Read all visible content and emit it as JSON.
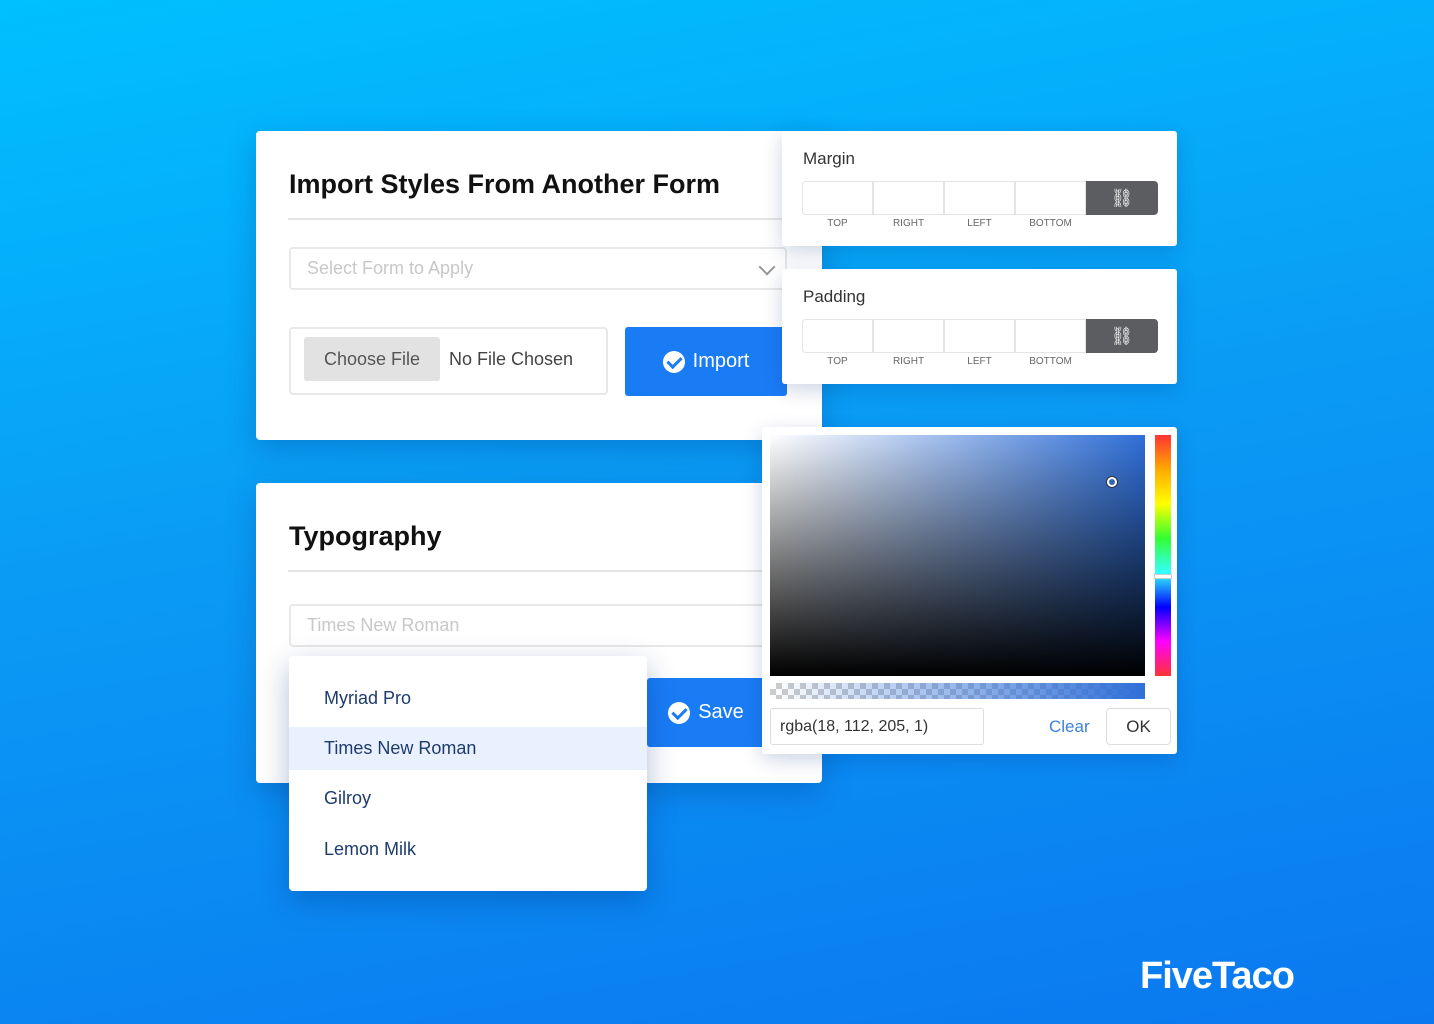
{
  "import_card": {
    "title": "Import Styles From Another Form",
    "select_placeholder": "Select Form to Apply",
    "choose_file": "Choose File",
    "no_file": "No File Chosen",
    "import_button": "Import"
  },
  "margin": {
    "title": "Margin",
    "labels": [
      "TOP",
      "RIGHT",
      "LEFT",
      "BOTTOM"
    ],
    "link_icon": "unlink-icon"
  },
  "padding": {
    "title": "Padding",
    "labels": [
      "TOP",
      "RIGHT",
      "LEFT",
      "BOTTOM"
    ],
    "link_icon": "unlink-icon"
  },
  "typography": {
    "title": "Typography",
    "select_value": "Times New Roman",
    "save_button": "Save",
    "options": [
      "Myriad Pro",
      "Times New Roman",
      "Gilroy",
      "Lemon Milk"
    ],
    "highlighted": "Times New Roman"
  },
  "color_picker": {
    "value": "rgba(18, 112, 205, 1)",
    "clear": "Clear",
    "ok": "OK",
    "hue_color": "#1270cd"
  },
  "brand": {
    "logo": "FiveTaco"
  },
  "colors": {
    "accent": "#1a7cf5",
    "link_button": "#5c5d60"
  }
}
